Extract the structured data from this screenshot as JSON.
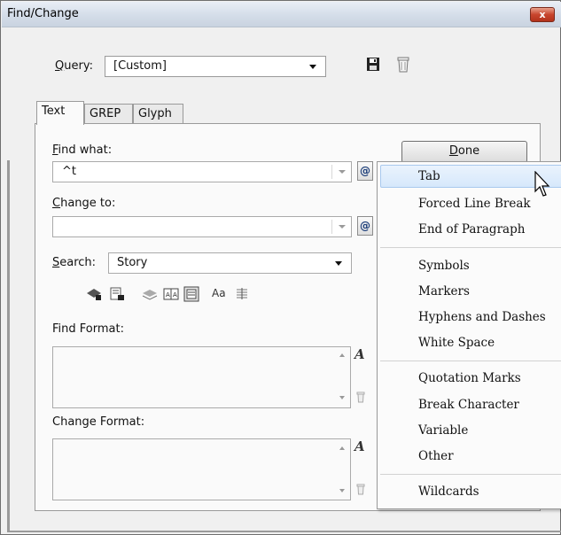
{
  "window": {
    "title": "Find/Change",
    "close_glyph": "x"
  },
  "query": {
    "label_prefix": "",
    "label_accel": "Q",
    "label_rest": "uery:",
    "value": "[Custom]",
    "icons": [
      "save-query-icon",
      "delete-query-icon"
    ]
  },
  "tabs": [
    {
      "label": "Text",
      "active": true
    },
    {
      "label": "GREP",
      "active": false
    },
    {
      "label": "Glyph",
      "active": false
    }
  ],
  "find_what": {
    "label_accel": "F",
    "label_rest": "ind what:",
    "value": "^t"
  },
  "change_to": {
    "label_accel": "C",
    "label_rest": "hange to:",
    "value": ""
  },
  "search": {
    "label_accel": "S",
    "label_rest": "earch:",
    "value": "Story"
  },
  "special_char_button": "@",
  "find_format": {
    "label": "Find Format:"
  },
  "change_format": {
    "label": "Change Format:"
  },
  "done": {
    "label_accel": "D",
    "label_rest": "one"
  },
  "option_icons": [
    "include-locked-layers-icon",
    "include-locked-stories-icon",
    "include-hidden-layers-icon",
    "include-master-pages-icon",
    "include-footnotes-icon",
    "case-sensitive-icon",
    "whole-word-icon"
  ],
  "case_sensitive_label": "Aa",
  "menu": {
    "items": [
      {
        "label": "Tab",
        "highlighted": true
      },
      {
        "label": "Forced Line Break"
      },
      {
        "label": "End of Paragraph"
      },
      {
        "label": "Symbols"
      },
      {
        "label": "Markers"
      },
      {
        "label": "Hyphens and Dashes"
      },
      {
        "label": "White Space"
      },
      {
        "label": "Quotation Marks"
      },
      {
        "label": "Break Character"
      },
      {
        "label": "Variable"
      },
      {
        "label": "Other"
      },
      {
        "label": "Wildcards"
      }
    ],
    "highlight_color": "#d6e8fb"
  },
  "colors": {
    "title_bar": "#d4dde9",
    "close_button": "#c8452d",
    "panel_bg": "#fafafa"
  }
}
